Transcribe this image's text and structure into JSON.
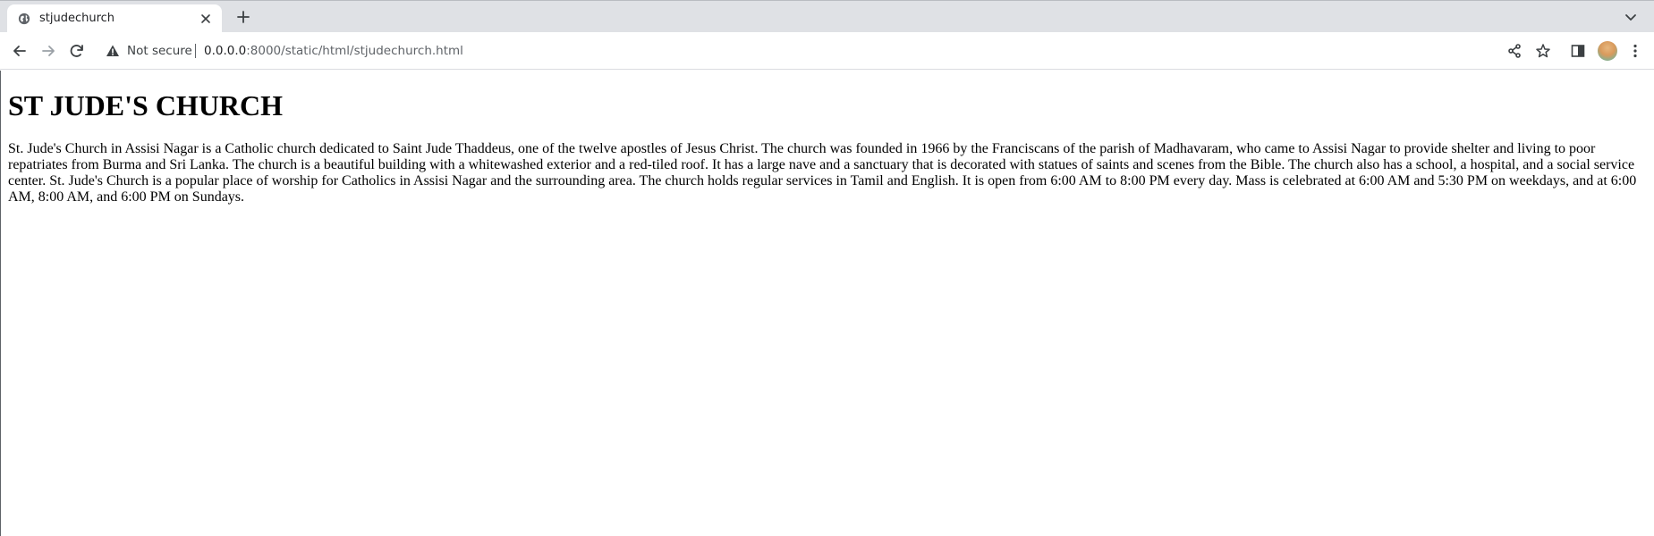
{
  "browser": {
    "tab": {
      "title": "stjudechurch",
      "favicon": "globe-icon"
    },
    "toolbar": {
      "security_label": "Not secure",
      "url_host": "0.0.0.0",
      "url_rest": ":8000/static/html/stjudechurch.html"
    },
    "icons": {
      "back": "arrow-left-icon",
      "forward": "arrow-right-icon",
      "reload": "reload-icon",
      "share": "share-icon",
      "bookmark": "star-icon",
      "side_panel": "side-panel-icon",
      "menu": "kebab-menu-icon",
      "tab_search": "chevron-down-icon",
      "new_tab": "plus-icon",
      "close_tab": "close-icon"
    },
    "colors": {
      "tabstrip_bg": "#dfe1e5",
      "warning": "#5f6368"
    }
  },
  "page": {
    "heading": "ST JUDE'S CHURCH",
    "body": "St. Jude's Church in Assisi Nagar is a Catholic church dedicated to Saint Jude Thaddeus, one of the twelve apostles of Jesus Christ. The church was founded in 1966 by the Franciscans of the parish of Madhavaram, who came to Assisi Nagar to provide shelter and living to poor repatriates from Burma and Sri Lanka. The church is a beautiful building with a whitewashed exterior and a red-tiled roof. It has a large nave and a sanctuary that is decorated with statues of saints and scenes from the Bible. The church also has a school, a hospital, and a social service center. St. Jude's Church is a popular place of worship for Catholics in Assisi Nagar and the surrounding area. The church holds regular services in Tamil and English. It is open from 6:00 AM to 8:00 PM every day. Mass is celebrated at 6:00 AM and 5:30 PM on weekdays, and at 6:00 AM, 8:00 AM, and 6:00 PM on Sundays."
  }
}
